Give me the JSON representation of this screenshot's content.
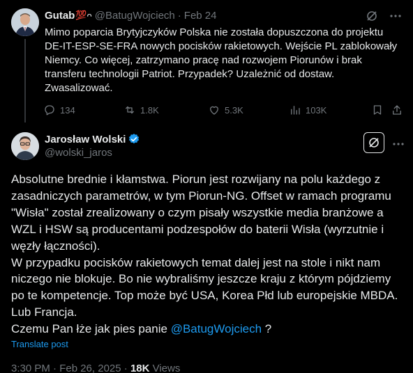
{
  "parent_tweet": {
    "author_name": "Gutab",
    "emoji_hundred": "💯",
    "emoji_extra": "ᴖ",
    "handle": "@BatugWojciech",
    "separator": "·",
    "date": "Feb 24",
    "body_lines": [
      "Mimo poparcia Brytyjczyków Polska nie została dopuszczona do projektu",
      "DE-IT-ESP-SE-FRA nowych pocisków rakietowych. Wejście PL zablokowały",
      "Niemcy. Co więcej, zatrzymano pracę nad rozwojem Piorunów i brak",
      "transferu technologii Patriot. Przypadek? Uzależnić od dostaw.",
      "Zwasalizować."
    ],
    "stats": {
      "replies": "134",
      "reposts": "1.8K",
      "likes": "5.3K",
      "views": "103K"
    }
  },
  "main_tweet": {
    "author_name": "Jarosław Wolski",
    "handle": "@wolski_jaros",
    "verified": true,
    "body_lines": [
      "Absolutne brednie i kłamstwa.  Piorun jest rozwijany na polu każdego z",
      "zasadniczych parametrów, w tym Piorun-NG. Offset w ramach programu",
      "\"Wisła\" został zrealizowany o czym pisały wszystkie media branżowe a",
      "WZL i HSW są producentami podzespołów do baterii Wisła (wyrzutnie i",
      "węzły łączności).",
      "W przypadku pocisków rakietowych temat dalej jest na stole i nikt nam",
      "niczego nie blokuje. Bo nie wybraliśmy jeszcze kraju z którym pójdziemy",
      "po te kompetencje. Top może być USA, Korea Płd lub europejskie MBDA.",
      "Lub Francja."
    ],
    "last_line_prefix": "Czemu Pan łże jak pies panie ",
    "mention": "@BatugWojciech",
    "last_line_suffix": " ?",
    "translate_label": "Translate post",
    "time": "3:30 PM · Feb 26, 2025 · ",
    "views_count": "18K",
    "views_label": " Views"
  },
  "colors": {
    "background": "#000000",
    "text": "#e7e9ea",
    "muted": "#71767b",
    "accent": "#1d9bf0"
  },
  "icons": [
    "grok-icon",
    "more-icon",
    "reply-icon",
    "repost-icon",
    "like-icon",
    "views-icon",
    "bookmark-icon",
    "share-icon",
    "verified-badge-icon"
  ]
}
